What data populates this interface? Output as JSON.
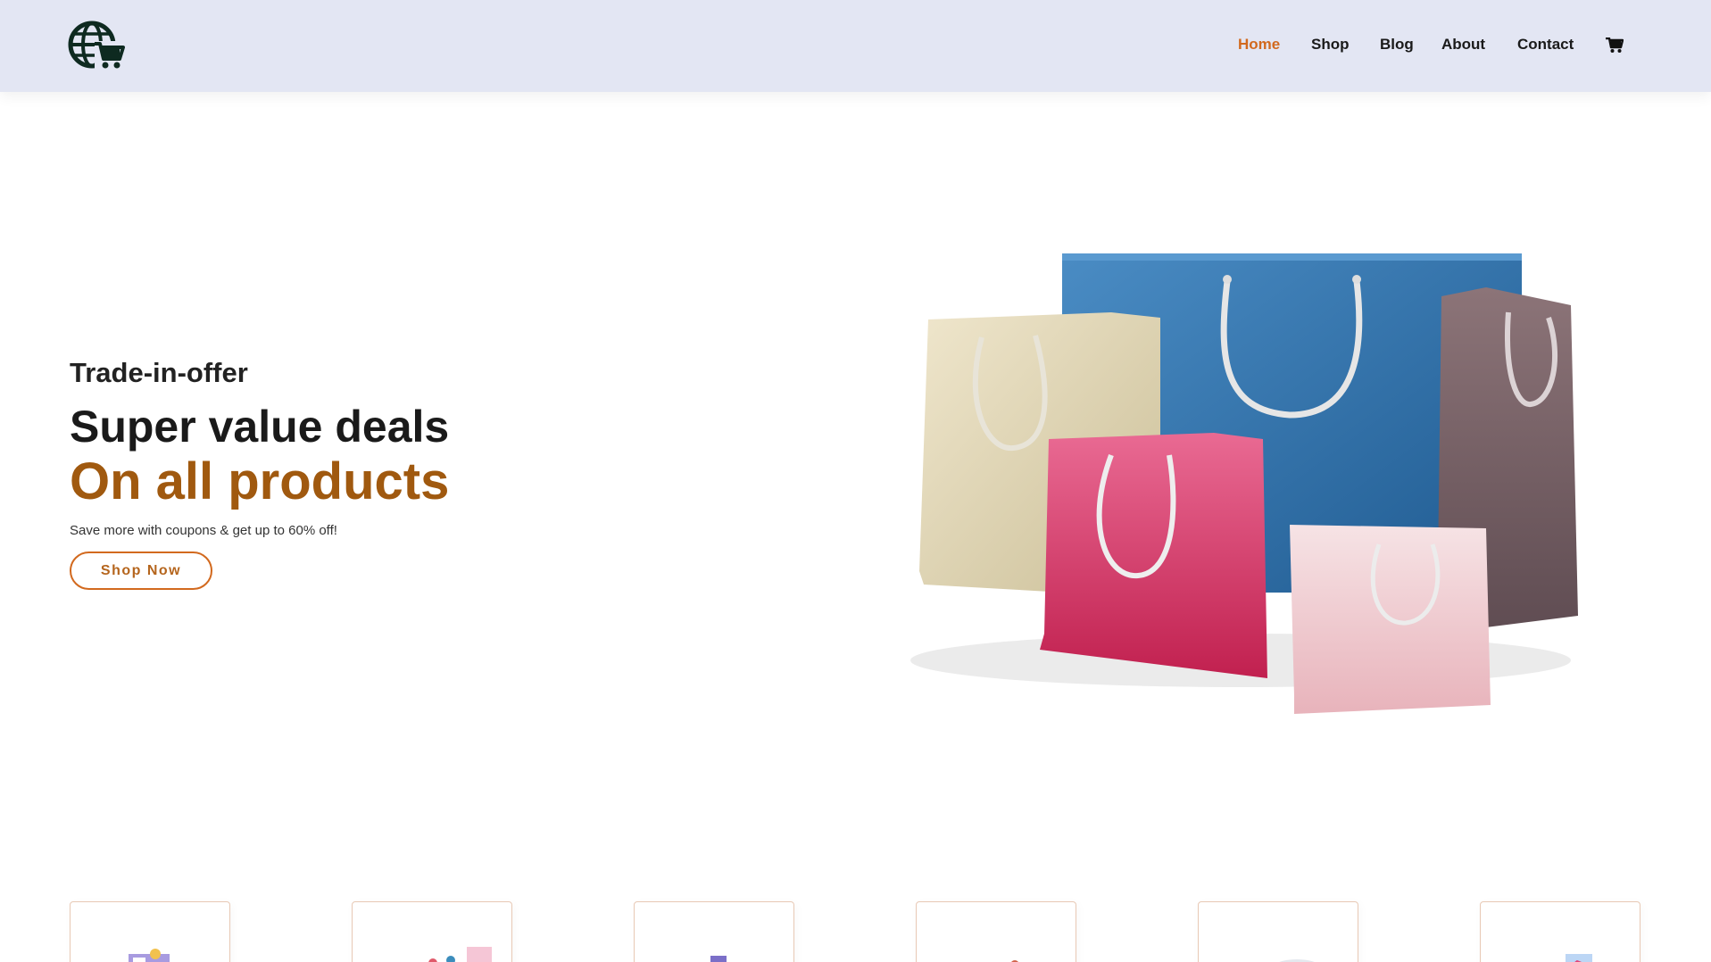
{
  "header": {
    "logo_icon": "globe-cart-icon",
    "nav": [
      {
        "label": "Home",
        "active": true
      },
      {
        "label": "Shop",
        "active": false
      },
      {
        "label": "Blog",
        "active": false
      },
      {
        "label": "About",
        "active": false
      },
      {
        "label": "Contact",
        "active": false
      }
    ],
    "cart_icon": "shopping-cart-icon"
  },
  "hero": {
    "subtitle": "Trade-in-offer",
    "title": "Super value deals",
    "title_highlight": "On all products",
    "description": "Save more with coupons & get up to 60% off!",
    "button_label": "Shop Now",
    "image": "shopping-bags-illustration"
  },
  "colors": {
    "header_bg": "#e3e6f3",
    "accent": "#d2691e",
    "highlight_text": "#a0590f"
  },
  "features": {
    "cards": [
      {
        "icon": "feature-illustration-1"
      },
      {
        "icon": "feature-illustration-2"
      },
      {
        "icon": "feature-illustration-3"
      },
      {
        "icon": "feature-illustration-4"
      },
      {
        "icon": "feature-illustration-5"
      },
      {
        "icon": "feature-illustration-6"
      }
    ]
  }
}
